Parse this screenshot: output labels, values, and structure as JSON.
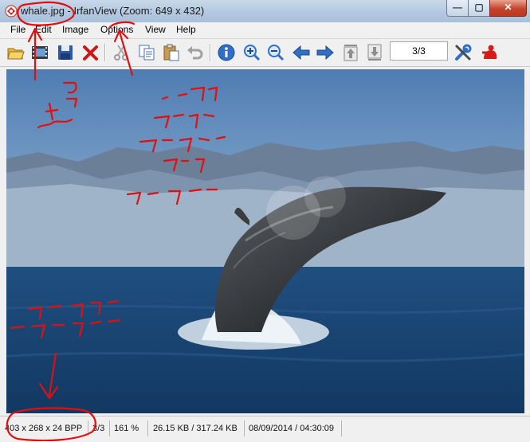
{
  "window": {
    "title": "whale.jpg - IrfanView (Zoom: 649 x 432)",
    "buttons": {
      "minimize": "—",
      "maximize": "▢",
      "close": "✕"
    }
  },
  "menu": [
    "File",
    "Edit",
    "Image",
    "Options",
    "View",
    "Help"
  ],
  "toolbar": {
    "icons": [
      "open-folder-icon",
      "slideshow-icon",
      "save-icon",
      "delete-icon",
      "cut-icon",
      "copy-icon",
      "paste-icon",
      "undo-icon",
      "info-icon",
      "zoom-in-icon",
      "zoom-out-icon",
      "previous-icon",
      "next-icon",
      "first-page-icon",
      "last-page-icon",
      "settings-icon",
      "exit-icon"
    ],
    "page_value": "3/3"
  },
  "status": {
    "dimensions": "403 x 268 x 24 BPP",
    "index": "3/3",
    "zoom": "161 %",
    "size": "26.15 KB / 317.24 KB",
    "datetime": "08/09/2014 / 04:30:09"
  },
  "colors": {
    "annotation": "#e01010",
    "accent": "#2f6fc4"
  }
}
